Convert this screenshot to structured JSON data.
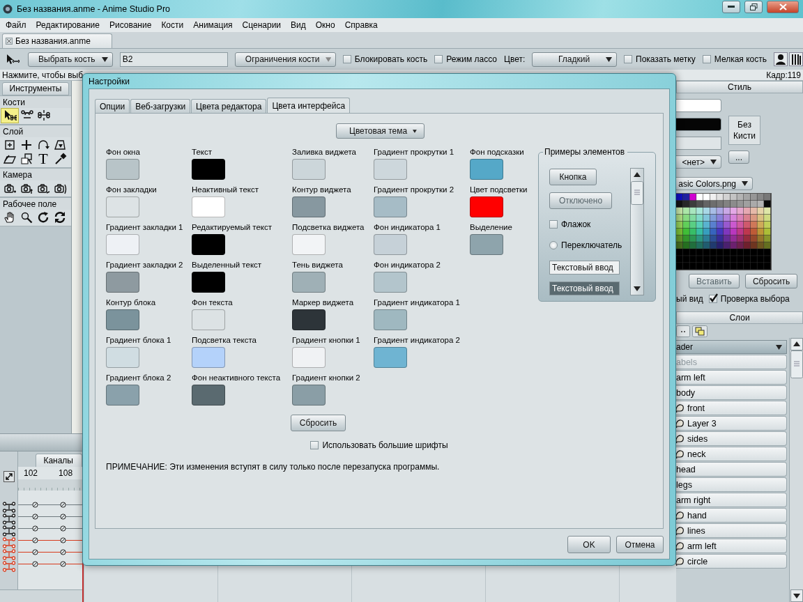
{
  "window": {
    "title": "Без названия.anme - Anime Studio Pro"
  },
  "menu": [
    "Файл",
    "Редактирование",
    "Рисование",
    "Кости",
    "Анимация",
    "Сценарии",
    "Вид",
    "Окно",
    "Справка"
  ],
  "document_tab": {
    "label": "Без названия.anme"
  },
  "toolbar": {
    "bone_mode": "Выбрать кость",
    "bone_name": "B2",
    "constraints": "Ограничения кости",
    "checkboxes": [
      {
        "label": "Блокировать кость",
        "checked": false
      },
      {
        "label": "Режим лассо",
        "checked": false
      }
    ],
    "color_label": "Цвет:",
    "color_mode": "Гладкий",
    "checkboxes_2": [
      {
        "label": "Показать метку",
        "checked": false
      },
      {
        "label": "Мелкая кость",
        "checked": false
      }
    ]
  },
  "status_bar": {
    "hint": "Нажмите, чтобы выб",
    "frame": "Кадр:119"
  },
  "tools": {
    "title": "Инструменты",
    "sections": [
      {
        "label": "Кости",
        "tools": [
          {
            "selected": true
          },
          {
            "selected": false
          },
          {
            "selected": false
          }
        ]
      },
      {
        "label": "Слой",
        "tools": [
          {
            "selected": false
          },
          {
            "selected": false
          },
          {
            "selected": false
          },
          {
            "selected": false
          },
          {
            "selected": false
          },
          {
            "selected": false
          },
          {
            "selected": false,
            "glyph": "T"
          },
          {
            "selected": false
          }
        ]
      },
      {
        "label": "Камера",
        "tools": [
          {
            "selected": false
          },
          {
            "selected": false
          },
          {
            "selected": false
          },
          {
            "selected": false
          }
        ]
      },
      {
        "label": "Рабочее поле",
        "tools": [
          {
            "selected": false
          },
          {
            "selected": false
          },
          {
            "selected": false
          },
          {
            "selected": false
          }
        ]
      }
    ]
  },
  "timeline": {
    "tab": "Каналы",
    "frames": [
      "102",
      "108"
    ],
    "channels": [
      {
        "color": "#1a1a1a"
      },
      {
        "color": "#1a1a1a"
      },
      {
        "color": "#1a1a1a"
      },
      {
        "color": "#d83a1c"
      },
      {
        "color": "#d83a1c"
      },
      {
        "color": "#d83a1c"
      }
    ]
  },
  "style_panel": {
    "title": "Стиль",
    "swatches": [
      {
        "color": "#ffffff"
      },
      {
        "color": "#050505"
      }
    ],
    "brush_button": "Без Кисти",
    "brush_select": "<нет>",
    "more_button": "...",
    "palette_file": "asic Colors.png",
    "buttons": [
      {
        "label": "Вставить",
        "disabled": true
      },
      {
        "label": "Сбросить",
        "disabled": false
      }
    ],
    "view_text": "ый вид",
    "check": {
      "label": "Проверка выбора",
      "checked": true
    }
  },
  "layers_panel": {
    "title": "Слои",
    "current": "ader",
    "layers": [
      {
        "name": "abels",
        "kind": "group",
        "disabled": true
      },
      {
        "name": "arm left",
        "kind": "group",
        "disabled": false
      },
      {
        "name": "body",
        "kind": "group",
        "disabled": false
      },
      {
        "name": "front",
        "kind": "vector",
        "disabled": false
      },
      {
        "name": "Layer 3",
        "kind": "vector",
        "disabled": false
      },
      {
        "name": "sides",
        "kind": "vector",
        "disabled": false
      },
      {
        "name": "neck",
        "kind": "vector",
        "disabled": false
      },
      {
        "name": "head",
        "kind": "group",
        "disabled": false
      },
      {
        "name": "legs",
        "kind": "group",
        "disabled": false
      },
      {
        "name": "arm right",
        "kind": "group",
        "disabled": false
      },
      {
        "name": "hand",
        "kind": "vector",
        "disabled": false
      },
      {
        "name": "lines",
        "kind": "vector",
        "disabled": false
      },
      {
        "name": "arm left",
        "kind": "vector",
        "disabled": false
      },
      {
        "name": "circle",
        "kind": "vector",
        "disabled": false
      }
    ]
  },
  "dialog": {
    "title": "Настройки",
    "tabs": [
      {
        "label": "Опции",
        "selected": false
      },
      {
        "label": "Веб-загрузки",
        "selected": false
      },
      {
        "label": "Цвета редактора",
        "selected": false
      },
      {
        "label": "Цвета интерфейса",
        "selected": true
      }
    ],
    "theme_button": "Цветовая тема",
    "color_columns": [
      [
        {
          "label": "Фон окна",
          "color": "#b8c4c8"
        },
        {
          "label": "Фон закладки",
          "color": "#dde3e5"
        },
        {
          "label": "Градиент закладки 1",
          "color": "#eef1f5"
        },
        {
          "label": "Градиент закладки 2",
          "color": "#8e9aa0"
        },
        {
          "label": "Контур блока",
          "color": "#7b939c"
        },
        {
          "label": "Градиент блока 1",
          "color": "#d0dde2"
        },
        {
          "label": "Градиент блока 2",
          "color": "#8aa1ab"
        }
      ],
      [
        {
          "label": "Текст",
          "color": "#000000"
        },
        {
          "label": "Неактивный текст",
          "color": "#ffffff"
        },
        {
          "label": "Редактируемый текст",
          "color": "#000000"
        },
        {
          "label": "Выделенный текст",
          "color": "#000000"
        },
        {
          "label": "Фон текста",
          "color": "#dce2e4"
        },
        {
          "label": "Подсветка текста",
          "color": "#b4d2fa"
        },
        {
          "label": "Фон неактивного текста",
          "color": "#5a6a70"
        }
      ],
      [
        {
          "label": "Заливка виджета",
          "color": "#ccd6da"
        },
        {
          "label": "Контур виджета",
          "color": "#8798a0"
        },
        {
          "label": "Подсветка виджета",
          "color": "#f2f4f6"
        },
        {
          "label": "Тень виджета",
          "color": "#9fb0b6"
        },
        {
          "label": "Маркер виджета",
          "color": "#2d3439"
        },
        {
          "label": "Градиент кнопки 1",
          "color": "#f0f2f4"
        },
        {
          "label": "Градиент кнопки 2",
          "color": "#8a9ea6"
        }
      ],
      [
        {
          "label": "Градиент прокрутки 1",
          "color": "#cdd7dc"
        },
        {
          "label": "Градиент прокрутки 2",
          "color": "#a6bcc6"
        },
        {
          "label": "Фон индикатора 1",
          "color": "#c6d1d8"
        },
        {
          "label": "Фон индикатора 2",
          "color": "#b3c5cc"
        },
        {
          "label": "Градиент индикатора 1",
          "color": "#9fb8c0"
        },
        {
          "label": "Градиент индикатора 2",
          "color": "#6fb4d2"
        }
      ],
      [
        {
          "label": "Фон подсказки",
          "color": "#55a8c8"
        },
        {
          "label": "Цвет подсветки",
          "color": "#ff0000"
        },
        {
          "label": "Выделение",
          "color": "#8ea4ac"
        }
      ]
    ],
    "reset_button": "Сбросить",
    "large_fonts": {
      "label": "Использовать большие шрифты",
      "checked": false
    },
    "note": "ПРИМЕЧАНИЕ: Эти изменения вступят в силу только после перезапуска программы.",
    "samples": {
      "title": "Примеры элементов",
      "button": "Кнопка",
      "disabled_button": "Отключено",
      "checkbox": {
        "label": "Флажок",
        "checked": false
      },
      "radio": {
        "label": "Переключатель",
        "selected": false
      },
      "text_inputs": [
        {
          "value": "Текстовый ввод",
          "kind": "normal"
        },
        {
          "value": "Текстовый ввод",
          "kind": "inactive"
        }
      ]
    },
    "buttons": [
      "OK",
      "Отмена"
    ]
  }
}
